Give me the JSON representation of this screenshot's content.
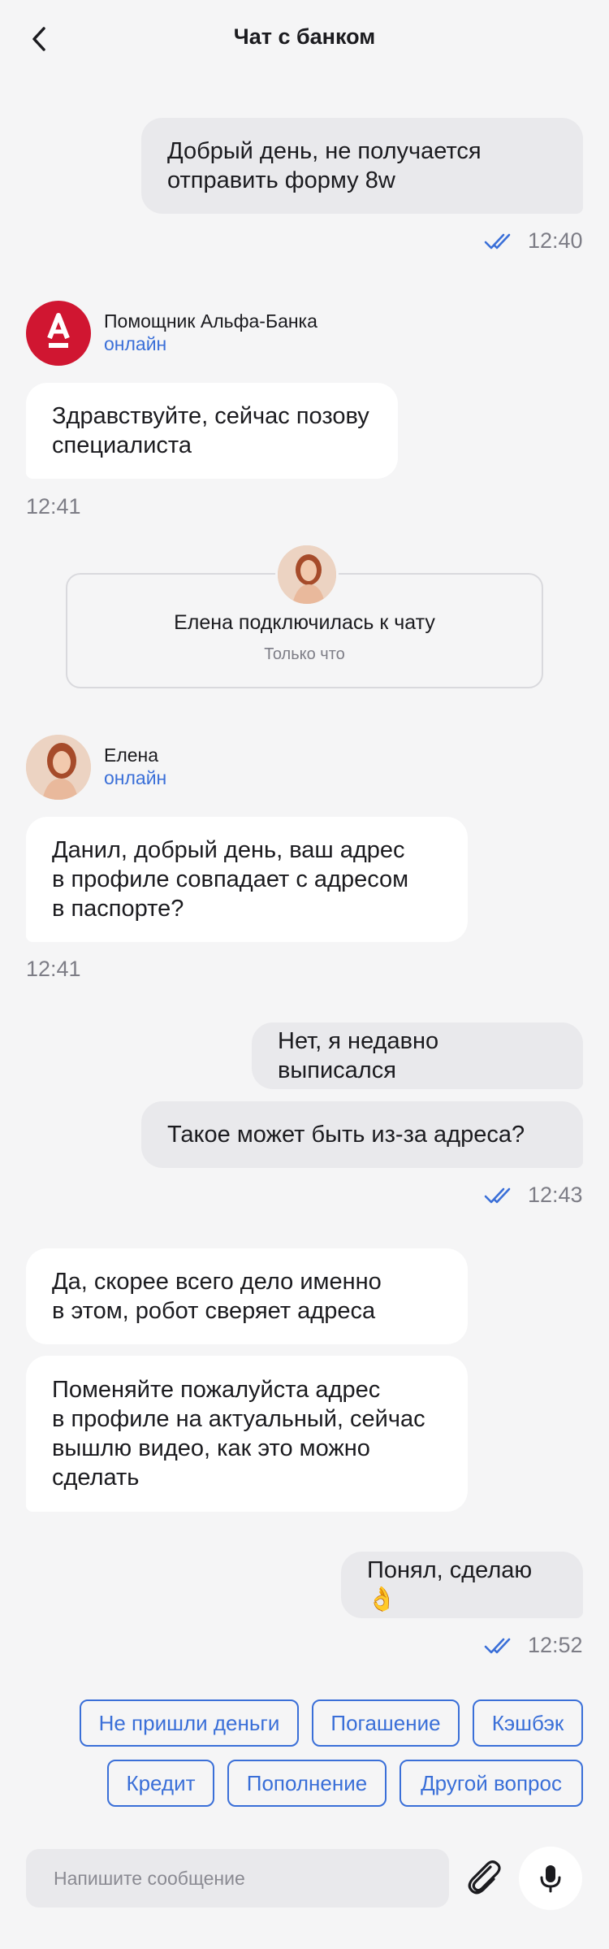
{
  "header": {
    "title": "Чат с банком"
  },
  "messages": {
    "m1": "Добрый день, не получается\nотправить форму 8w",
    "t1": "12:40",
    "m2": "Здравствуйте, сейчас позову\nспециалиста",
    "t2": "12:41",
    "m3": "Данил, добрый день, ваш адрес\nв профиле совпадает с адресом\nв паспорте?",
    "t3": "12:41",
    "m4": "Нет, я недавно выписался",
    "m5": "Такое может быть из-за адреса?",
    "t4": "12:43",
    "m6": "Да, скорее всего дело именно\nв этом, робот сверяет адреса",
    "m7": "Поменяйте пожалуйста адрес\nв профиле на актуальный, сейчас\nвышлю видео, как это можно\nсделать",
    "m8": "Понял, сделаю 👌",
    "t5": "12:52"
  },
  "bot": {
    "name": "Помощник Альфа-Банка",
    "status": "онлайн",
    "logo_letter": "А"
  },
  "agent": {
    "name": "Елена",
    "status": "онлайн"
  },
  "system": {
    "title": "Елена подключилась к чату",
    "subtitle": "Только что"
  },
  "quick_replies": [
    "Не пришли деньги",
    "Погашение",
    "Кэшбэк",
    "Кредит",
    "Пополнение",
    "Другой вопрос"
  ],
  "composer": {
    "placeholder": "Напишите сообщение"
  },
  "colors": {
    "accent": "#3a6fd8",
    "brand": "#d01631",
    "bg": "#f5f5f6"
  }
}
